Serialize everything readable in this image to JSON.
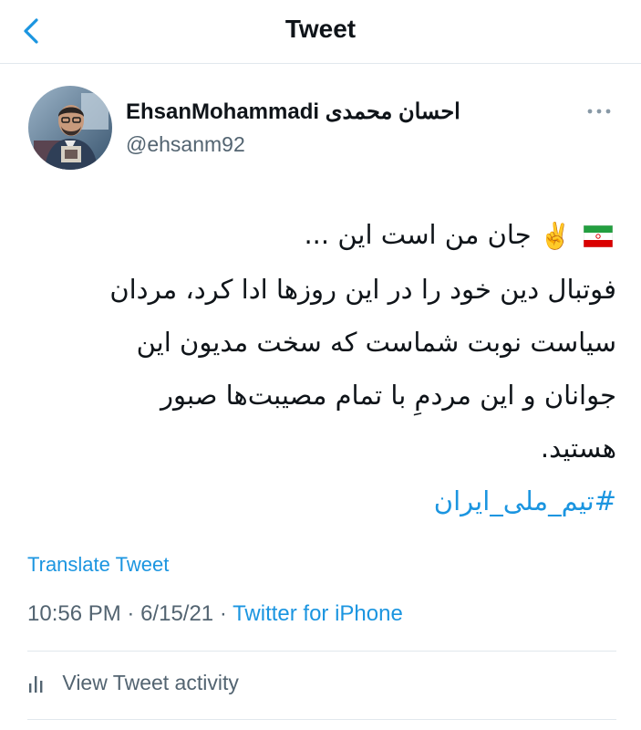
{
  "header": {
    "title": "Tweet"
  },
  "author": {
    "display_name": "EhsanMohammadi احسان محمدی",
    "handle": "@ehsanm92"
  },
  "tweet": {
    "lines": [
      "جان من است این ...",
      "فوتبال دین خود را در این روزها ادا کرد، مردان",
      "سیاست نوبت شماست که سخت مدیون این",
      "جوانان و این مردمِ با تمام مصیبت‌ها صبور",
      "هستید."
    ],
    "hashtag": "#تیم_ملی_ایران",
    "emoji": {
      "flag": "iran-flag-icon",
      "victory": "✌️"
    }
  },
  "actions": {
    "translate_label": "Translate Tweet",
    "view_activity_label": "View Tweet activity"
  },
  "meta": {
    "time": "10:56 PM",
    "date": "6/15/21",
    "separator": "·",
    "source": "Twitter for iPhone"
  },
  "colors": {
    "accent": "#1b95e0",
    "secondary_text": "#536471",
    "primary_text": "#0f1419",
    "divider": "#e1e8ed"
  },
  "icons": {
    "back": "back-chevron-icon",
    "more": "more-dots-icon",
    "activity": "activity-bars-icon"
  }
}
